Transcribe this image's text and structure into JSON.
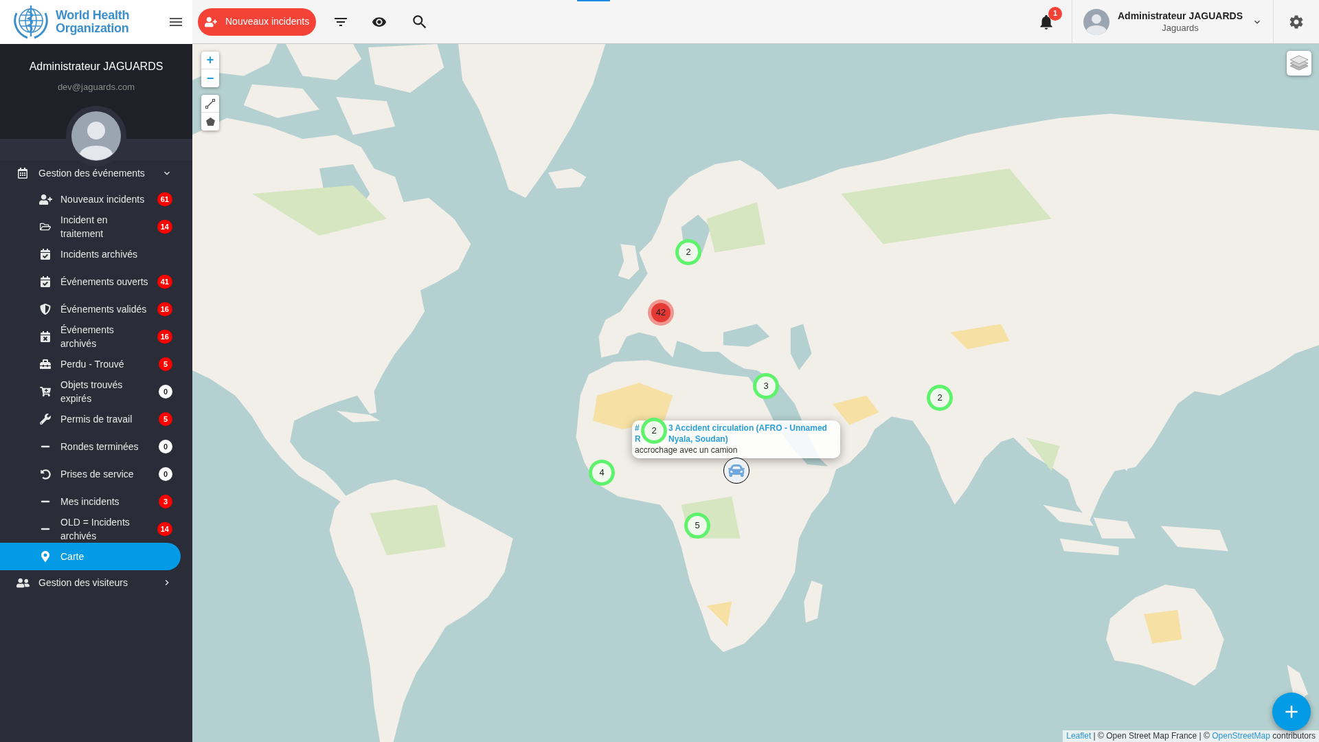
{
  "logo": {
    "lines": [
      "World Health",
      "Organization"
    ]
  },
  "topbar": {
    "new_incident_button": "Nouveaux incidents",
    "notification_count": "1",
    "user": {
      "name": "Administrateur JAGUARDS",
      "organization": "Jaguards"
    }
  },
  "sidebar": {
    "profile": {
      "name": "Administrateur JAGUARDS",
      "email": "dev@jaguards.com"
    },
    "groups": [
      {
        "label": "Gestion des événements",
        "expanded": true,
        "items": [
          {
            "label": "Nouveaux incidents",
            "selected": false,
            "badge": {
              "count": "61",
              "color": "#ff0000"
            }
          },
          {
            "label": "Incident en traitement",
            "selected": false,
            "badge": {
              "count": "14",
              "color": "#ff0000"
            }
          },
          {
            "label": "Incidents archivés",
            "selected": false
          },
          {
            "label": "Événements ouverts",
            "selected": false,
            "badge": {
              "count": "41",
              "color": "#ff0000"
            }
          },
          {
            "label": "Événements validés",
            "selected": false,
            "badge": {
              "count": "16",
              "color": "#ff0000"
            }
          },
          {
            "label": "Événements archivés",
            "selected": false,
            "badge": {
              "count": "16",
              "color": "#ff0000"
            }
          },
          {
            "label": "Perdu - Trouvé",
            "selected": false,
            "badge": {
              "count": "5",
              "color": "#ff0000"
            }
          },
          {
            "label": "Objets trouvés expirés",
            "selected": false,
            "badge": {
              "count": "0",
              "color": "#ffffff"
            }
          },
          {
            "label": "Permis de travail",
            "selected": false,
            "badge": {
              "count": "5",
              "color": "#ff0000"
            }
          },
          {
            "label": "Rondes terminées",
            "selected": false,
            "badge": {
              "count": "0",
              "color": "#ffffff"
            }
          },
          {
            "label": "Prises de service",
            "selected": false,
            "badge": {
              "count": "0",
              "color": "#ffffff"
            }
          },
          {
            "label": "Mes incidents",
            "selected": false,
            "badge": {
              "count": "3",
              "color": "#ff0000"
            }
          },
          {
            "label": "OLD = Incidents archivés",
            "selected": false,
            "badge": {
              "count": "14",
              "color": "#ff0000"
            }
          },
          {
            "label": "Carte",
            "selected": true
          }
        ]
      },
      {
        "label": "Gestion des visiteurs",
        "expanded": false
      }
    ]
  },
  "map": {
    "zoom_in": "+",
    "zoom_out": "−",
    "clusters": [
      {
        "count": "2",
        "kind": "small"
      },
      {
        "count": "42",
        "kind": "large"
      },
      {
        "count": "3",
        "kind": "small"
      },
      {
        "count": "2",
        "kind": "small"
      },
      {
        "count": "2",
        "kind": "small"
      },
      {
        "count": "4",
        "kind": "small"
      },
      {
        "count": "5",
        "kind": "small"
      }
    ],
    "popup": {
      "title_lines": [
        [
          "#",
          "3 Accident circulation (AFRO - Unnamed"
        ],
        [
          "R",
          "Nyala, Soudan)"
        ]
      ],
      "body": "accrochage avec un camion"
    },
    "attribution": [
      {
        "text": "Leaflet",
        "kind": "link"
      },
      {
        "text": " | © Open Street Map France | © ",
        "kind": "text"
      },
      {
        "text": "OpenStreetMap",
        "kind": "link"
      },
      {
        "text": " contributors",
        "kind": "text"
      }
    ]
  }
}
